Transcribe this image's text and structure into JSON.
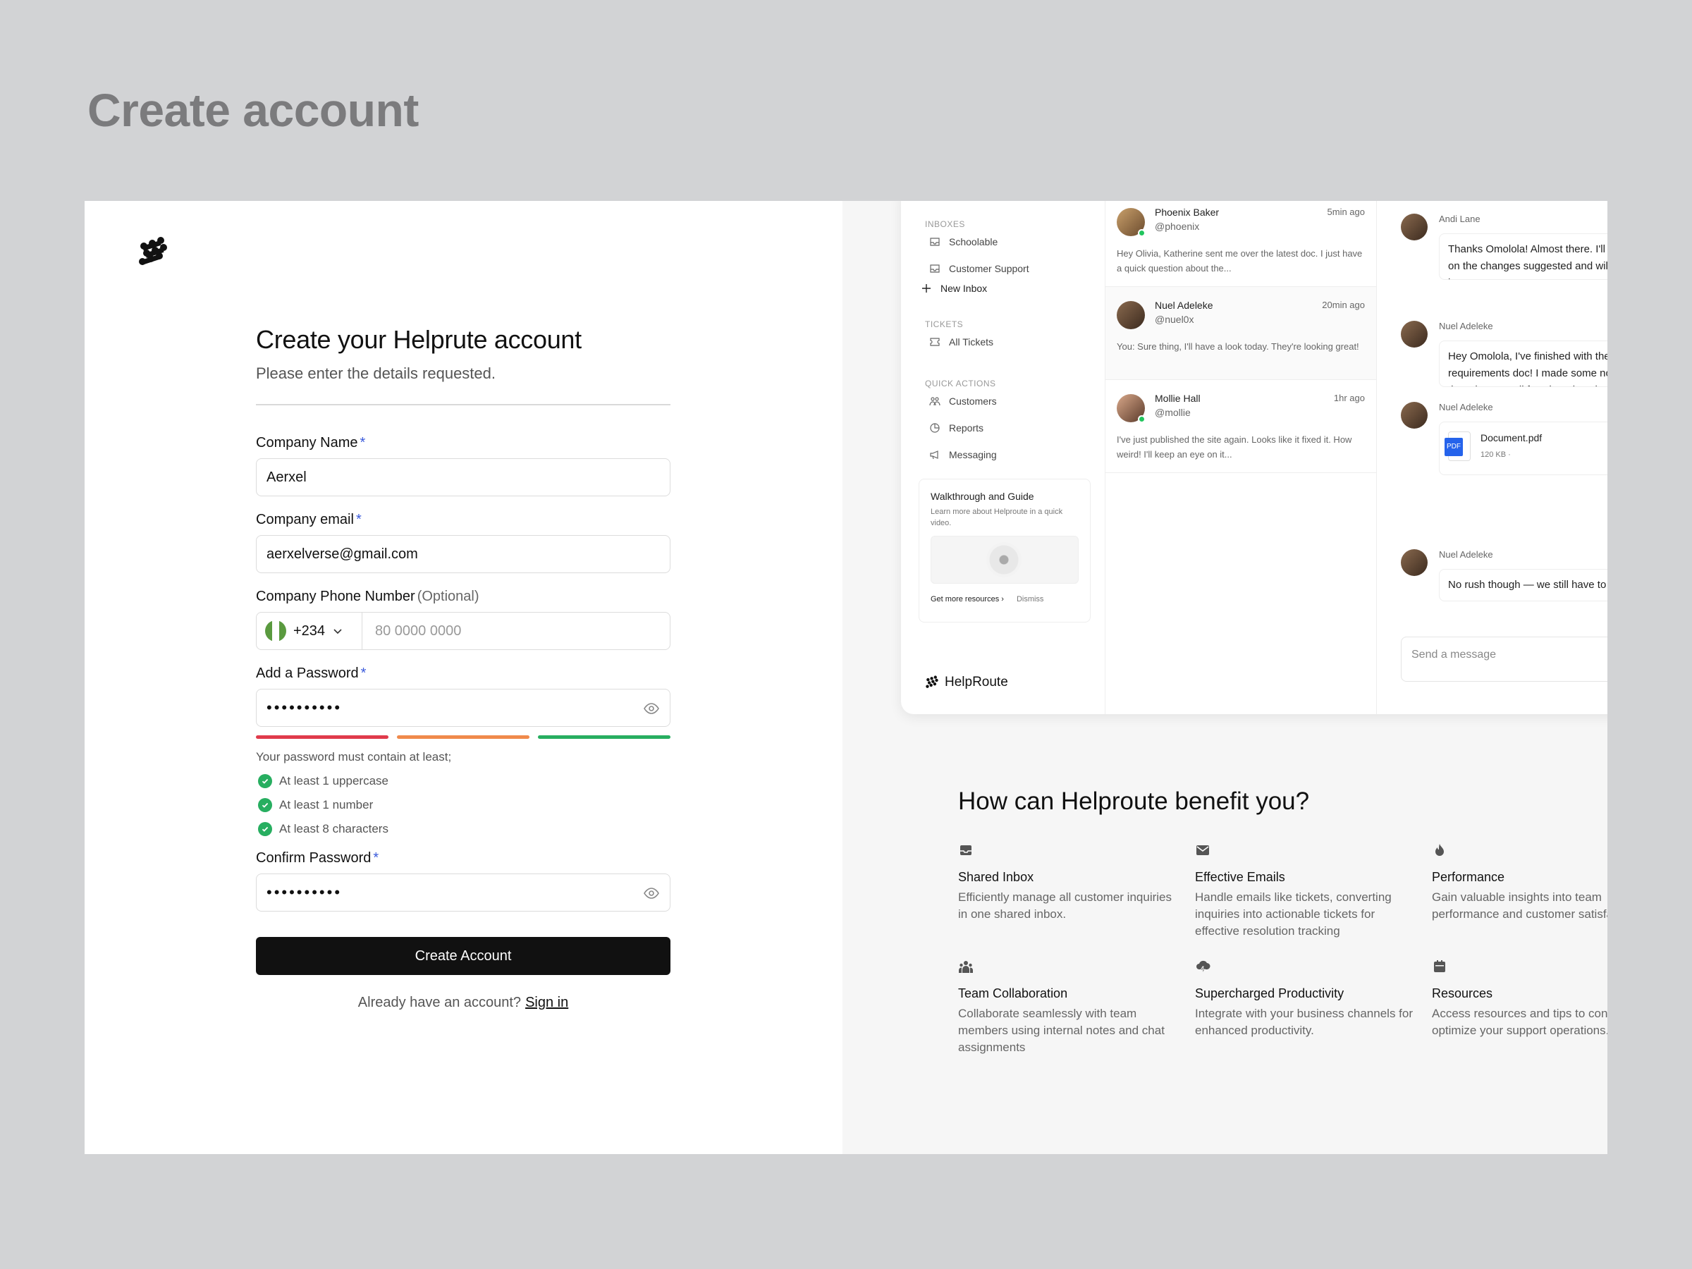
{
  "page_title": "Create account",
  "form": {
    "heading": "Create your Helprute account",
    "subheading": "Please enter the details requested.",
    "company_name": {
      "label": "Company Name",
      "required": "*",
      "value": "Aerxel"
    },
    "company_email": {
      "label": "Company email",
      "required": "*",
      "value": "aerxelverse@gmail.com"
    },
    "phone": {
      "label": "Company Phone Number",
      "optional": "(Optional)",
      "country_code": "+234",
      "placeholder": "80 0000 0000"
    },
    "password": {
      "label": "Add a Password",
      "required": "*",
      "value": "••••••••••"
    },
    "strength_colors": [
      "#e03b4b",
      "#f08a4b",
      "#27ae60"
    ],
    "hint": "Your password must contain at least;",
    "rules": [
      "At least 1 uppercase",
      "At least 1 number",
      "At least 8 characters"
    ],
    "confirm_password": {
      "label": "Confirm Password",
      "required": "*",
      "value": "••••••••••"
    },
    "submit_label": "Create Account",
    "signin_prompt": "Already have an account?",
    "signin_link": "Sign in"
  },
  "preview": {
    "sidebar": {
      "inboxes_label": "INBOXES",
      "inboxes": [
        "Schoolable",
        "Customer Support"
      ],
      "new_inbox": "New Inbox",
      "tickets_label": "TICKETS",
      "all_tickets": "All Tickets",
      "quick_actions_label": "QUICK ACTIONS",
      "quick_actions": [
        "Customers",
        "Reports",
        "Messaging"
      ],
      "walkthrough": {
        "title": "Walkthrough and Guide",
        "desc": "Learn more about Helproute in a quick video.",
        "more": "Get more resources",
        "dismiss": "Dismiss"
      },
      "brand": "HelpRoute"
    },
    "messages": [
      {
        "name": "Phoenix Baker",
        "handle": "@phoenix",
        "time": "5min ago",
        "body": "Hey Olivia, Katherine sent me over the latest doc. I just have a quick question about the...",
        "online": true
      },
      {
        "name": "Nuel Adeleke",
        "handle": "@nuel0x",
        "time": "20min ago",
        "body": "You: Sure thing, I'll have a look today. They're looking great!",
        "online": false
      },
      {
        "name": "Mollie Hall",
        "handle": "@mollie",
        "time": "1hr ago",
        "body": "I've just published the site again. Looks like it fixed it. How weird! I'll keep an eye on it...",
        "online": true
      }
    ],
    "chat": [
      {
        "name": "Andi Lane",
        "text": "Thanks Omolola! Almost there. I'll work on the changes suggested and will shoot it over."
      },
      {
        "name": "Nuel Adeleke",
        "text": "Hey Omolola, I've finished with the requirements doc! I made some notes in the gdoc as well for Phoenix to look over."
      },
      {
        "name": "Nuel Adeleke",
        "file_name": "Document.pdf",
        "file_size": "120 KB ·",
        "file_badge": "PDF"
      },
      {
        "name": "Nuel Adeleke",
        "text": "No rush though — we still have to wait for Lana's designs."
      }
    ],
    "send_placeholder": "Send a message"
  },
  "benefits": {
    "title": "How can Helproute benefit you?",
    "items": [
      {
        "icon": "inbox-icon",
        "title": "Shared Inbox",
        "desc": "Efficiently manage all customer inquiries in one shared inbox."
      },
      {
        "icon": "mail-icon",
        "title": "Effective Emails",
        "desc": "Handle emails like tickets, converting inquiries into actionable tickets for effective resolution tracking"
      },
      {
        "icon": "flame-icon",
        "title": "Performance",
        "desc": "Gain valuable insights into team performance and customer satisfaction"
      },
      {
        "icon": "team-icon",
        "title": "Team Collaboration",
        "desc": "Collaborate seamlessly with team members using internal notes and chat assignments"
      },
      {
        "icon": "cloud-bolt-icon",
        "title": "Supercharged Productivity",
        "desc": "Integrate with your business channels for enhanced productivity."
      },
      {
        "icon": "calendar-icon",
        "title": "Resources",
        "desc": "Access resources and tips to continuously optimize your support operations."
      }
    ]
  }
}
